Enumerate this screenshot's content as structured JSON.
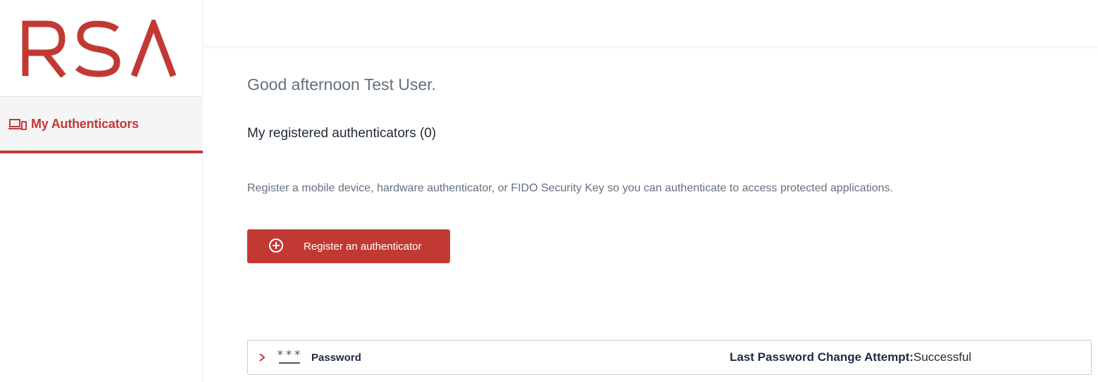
{
  "brand": {
    "logo_text": "RSA",
    "accent_color": "#c23934"
  },
  "sidebar": {
    "items": [
      {
        "label": "My Authenticators",
        "icon": "devices-icon",
        "active": true
      }
    ]
  },
  "main": {
    "greeting": "Good afternoon Test User.",
    "registered_title": "My registered authenticators (0)",
    "description": "Register a mobile device, hardware authenticator, or FIDO Security Key so you can authenticate to access protected applications.",
    "register_button": {
      "label": "Register an authenticator",
      "icon": "plus-circle-icon"
    },
    "password_card": {
      "icon_stars": "***",
      "name": "Password",
      "status_label": "Last Password Change Attempt:",
      "status_value": "Successful"
    }
  }
}
